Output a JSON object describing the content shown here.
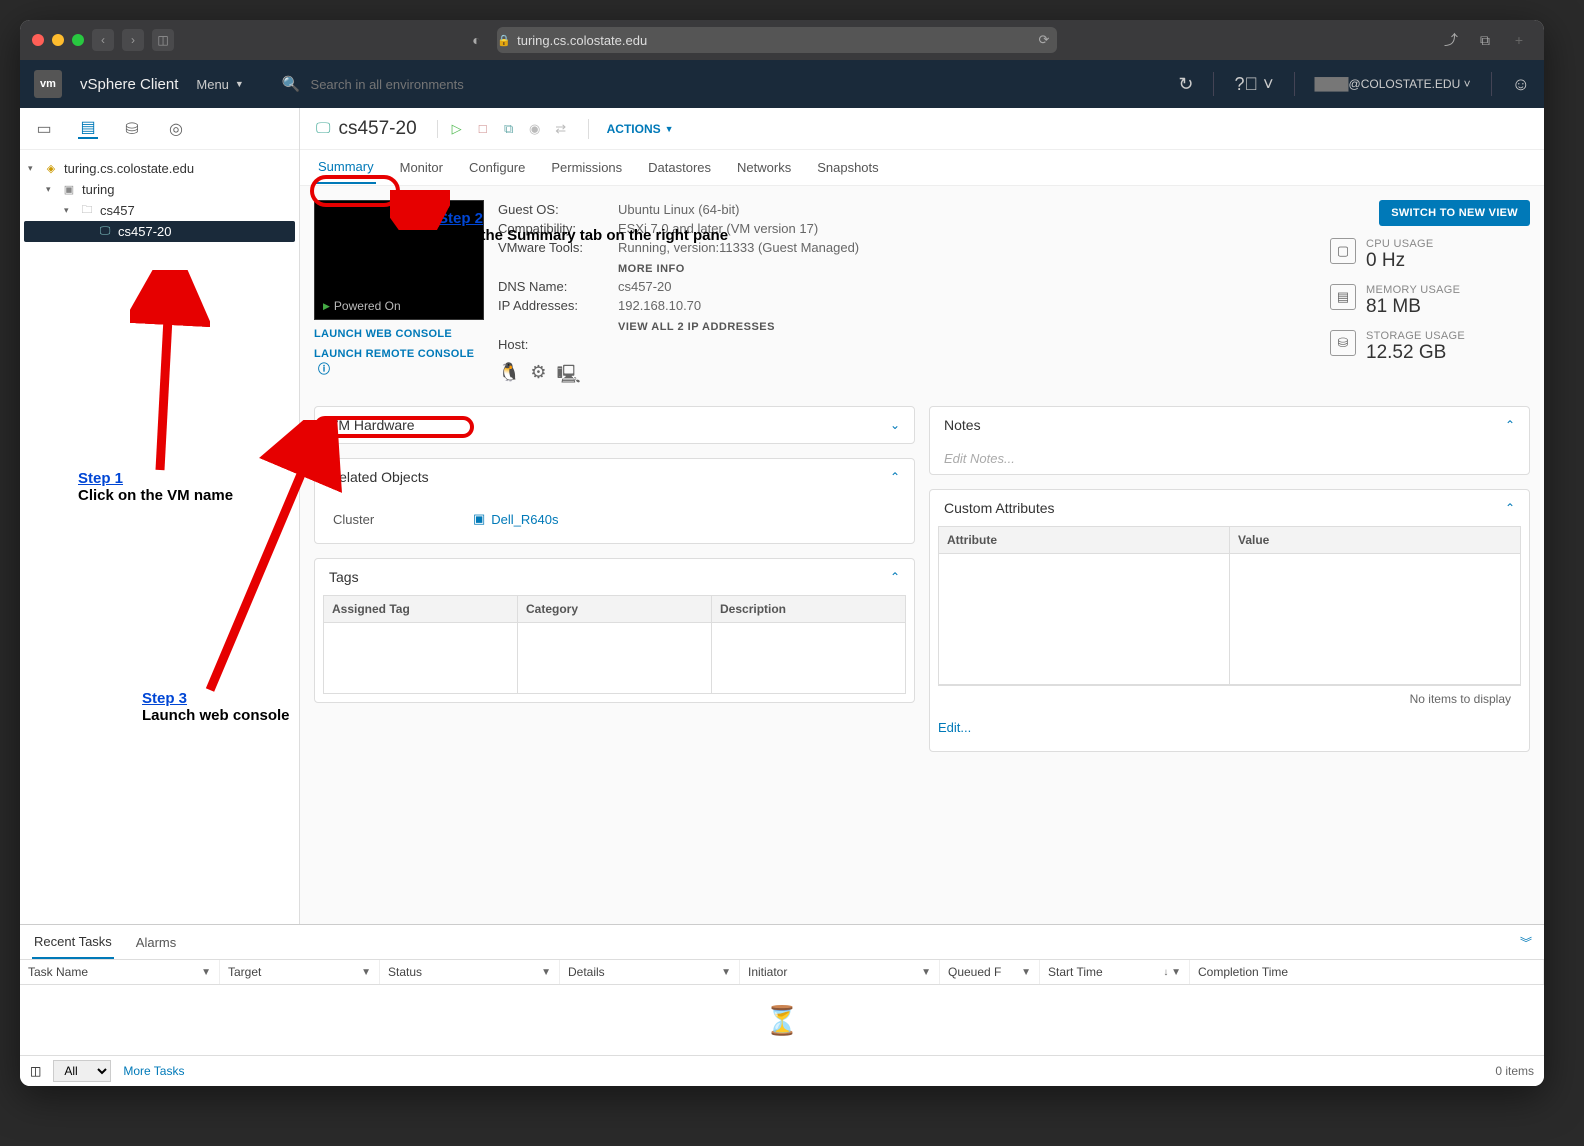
{
  "browser": {
    "url": "turing.cs.colostate.edu"
  },
  "header": {
    "logo": "vm",
    "title": "vSphere Client",
    "menu": "Menu",
    "search_placeholder": "Search in all environments",
    "user": "@COLOSTATE.EDU"
  },
  "tree": {
    "root": "turing.cs.colostate.edu",
    "host": "turing",
    "folder": "cs457",
    "vm": "cs457-20"
  },
  "page": {
    "title": "cs457-20",
    "actions": "ACTIONS",
    "tabs": [
      "Summary",
      "Monitor",
      "Configure",
      "Permissions",
      "Datastores",
      "Networks",
      "Snapshots"
    ]
  },
  "console": {
    "state": "Powered On",
    "web": "LAUNCH WEB CONSOLE",
    "remote": "LAUNCH REMOTE CONSOLE"
  },
  "info": {
    "guest_os_l": "Guest OS:",
    "guest_os": "Ubuntu Linux (64-bit)",
    "compat_l": "Compatibility:",
    "compat": "ESXi 7.0 and later (VM version 17)",
    "tools_l": "VMware Tools:",
    "tools": "Running, version:11333 (Guest Managed)",
    "more_info": "MORE INFO",
    "dns_l": "DNS Name:",
    "dns": "cs457-20",
    "ip_l": "IP Addresses:",
    "ip": "192.168.10.70",
    "view_ips": "VIEW ALL 2 IP ADDRESSES",
    "host_l": "Host:"
  },
  "switch_view": "SWITCH TO NEW VIEW",
  "usage": {
    "cpu_l": "CPU USAGE",
    "cpu": "0 Hz",
    "mem_l": "MEMORY USAGE",
    "mem": "81 MB",
    "sto_l": "STORAGE USAGE",
    "sto": "12.52 GB"
  },
  "cards": {
    "vm_hardware": "VM Hardware",
    "related": "Related Objects",
    "cluster_l": "Cluster",
    "cluster_v": "Dell_R640s",
    "tags": "Tags",
    "tags_cols": [
      "Assigned Tag",
      "Category",
      "Description"
    ],
    "notes": "Notes",
    "notes_ph": "Edit Notes...",
    "custom": "Custom Attributes",
    "custom_cols": [
      "Attribute",
      "Value"
    ],
    "no_items": "No items to display",
    "edit": "Edit..."
  },
  "bottom": {
    "recent": "Recent Tasks",
    "alarms": "Alarms",
    "cols": [
      "Task Name",
      "Target",
      "Status",
      "Details",
      "Initiator",
      "Queued F",
      "Start Time",
      "Completion Time"
    ],
    "all": "All",
    "more": "More Tasks",
    "count": "0 items"
  },
  "annotations": {
    "step1_t": "Step 1",
    "step1_d": "Click on the VM name",
    "step2_t": "Step 2",
    "step2_d": "Open the Summary tab on the right pane",
    "step3_t": "Step 3",
    "step3_d": "Launch web console"
  }
}
